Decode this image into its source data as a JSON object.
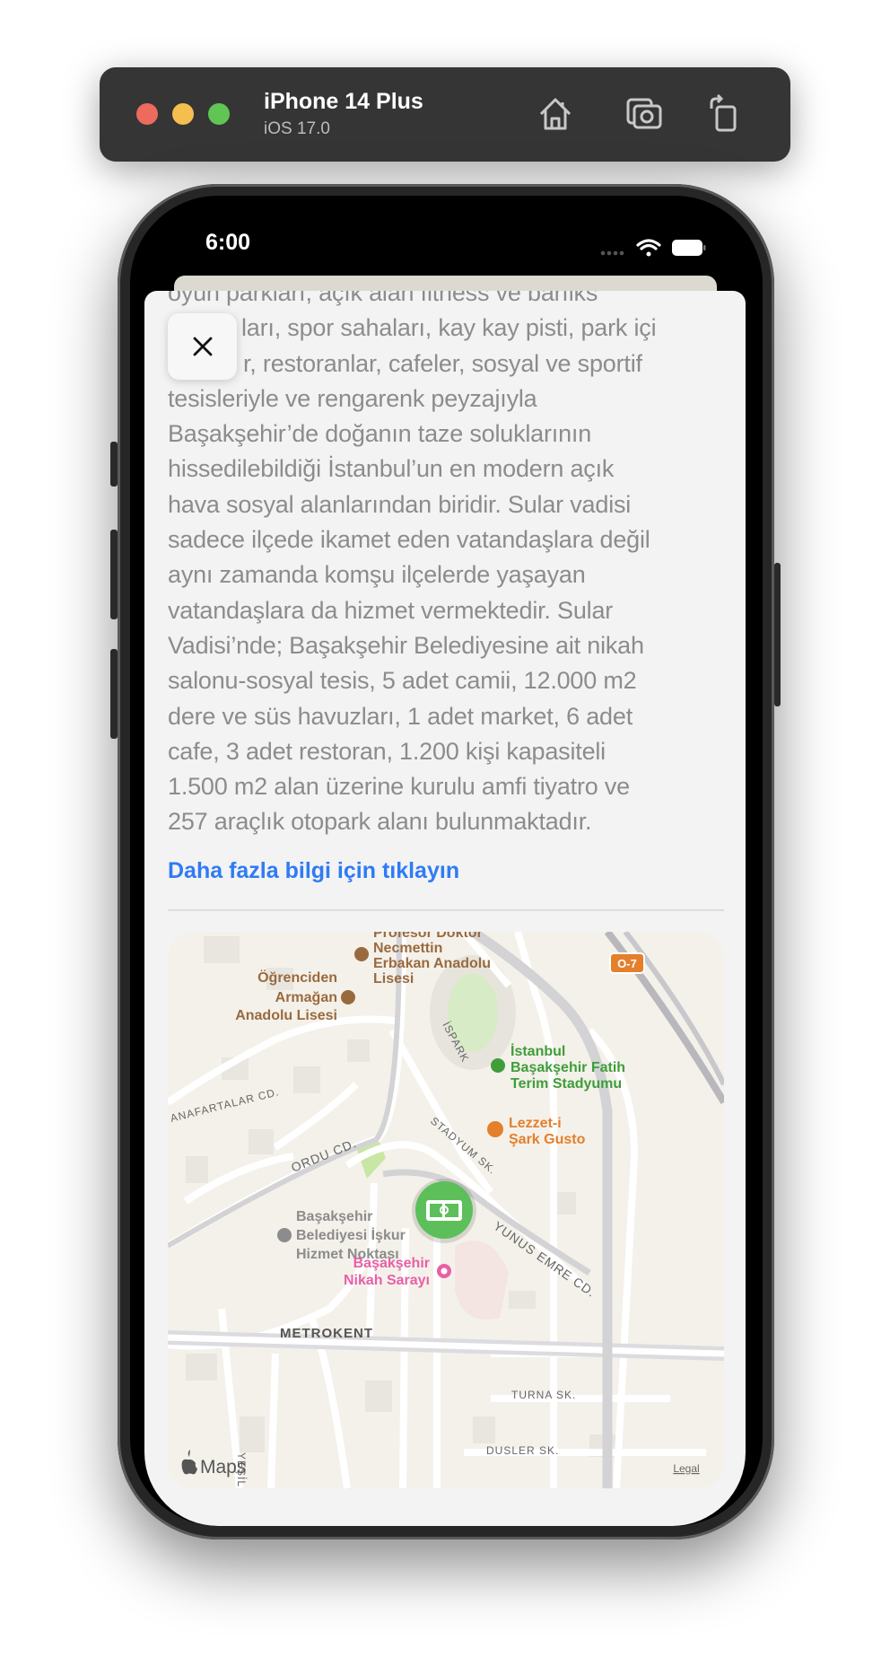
{
  "simulator": {
    "device_name": "iPhone 14 Plus",
    "os_version": "iOS 17.0",
    "traffic_lights": {
      "close": "#ed6a5e",
      "minimize": "#f5bf4f",
      "zoom": "#61c554"
    },
    "icons": [
      "home-icon",
      "screenshot-icon",
      "rotate-icon"
    ]
  },
  "status_bar": {
    "time": "6:00"
  },
  "sheet": {
    "close_icon": "xmark-icon",
    "description_lines": [
      "oyun parkları, açık alan fitness ve barfiks",
      "ları, spor sahaları, kay kay pisti, park içi",
      "r, restoranlar, cafeler, sosyal ve sportif",
      "tesisleriyle ve rengarenk peyzajıyla",
      "Başakşehir’de doğanın taze soluklarının",
      "hissedilebildiği İstanbul’un en modern açık",
      "hava sosyal alanlarından biridir. Sular vadisi",
      "sadece ilçede ikamet eden vatandaşlara değil",
      "aynı zamanda komşu ilçelerde yaşayan",
      "vatandaşlara da hizmet vermektedir. Sular",
      "Vadisi’nde; Başakşehir Belediyesine ait nikah",
      "salonu-sosyal tesis, 5 adet camii, 12.000 m2",
      "dere ve süs havuzları, 1 adet market, 6 adet",
      "cafe, 3 adet restoran, 1.200 kişi kapasiteli",
      "1.500 m2 alan üzerine kurulu amfi tiyatro ve",
      "257 araçlık otopark alanı bulunmaktadır."
    ],
    "more_info_link": "Daha fazla bilgi için tıklayın",
    "link_color": "#2f7bf5"
  },
  "map": {
    "pois": {
      "school1": [
        "Profesor Doktor",
        "Necmettin",
        "Erbakan Anadolu",
        "Lisesi"
      ],
      "school2": [
        "Öğrenciden",
        "Armağan",
        "Anadolu Lisesi"
      ],
      "stadium": [
        "İstanbul",
        "Başakşehir Fatih",
        "Terim Stadyumu"
      ],
      "restaurant": [
        "Lezzet-i",
        "Şark Gusto"
      ],
      "office": [
        "Başakşehir",
        "Belediyesi İşkur",
        "Hizmet Noktası"
      ],
      "wedding": [
        "Başakşehir",
        "Nikah Sarayı"
      ]
    },
    "streets": {
      "ordu": "ORDU CD.",
      "anafartalar": "ANAFARTALAR CD.",
      "stadyum": "STADYUM SK.",
      "ispark": "İSPARK",
      "yunus": "YUNUS EMRE CD.",
      "turna": "TURNA SK.",
      "dusler": "DUSLER SK.",
      "yesil": "YEŞİL V"
    },
    "district": "METROKENT",
    "highway_shield": "O-7",
    "attribution": "Maps",
    "legal": "Legal",
    "pin_icon": "soccer-field-icon",
    "colors": {
      "school": "#9a6a3f",
      "park": "#3f9d3a",
      "food": "#e47f2c",
      "wedding": "#e860a6",
      "pin": "#5cbf5a"
    }
  }
}
